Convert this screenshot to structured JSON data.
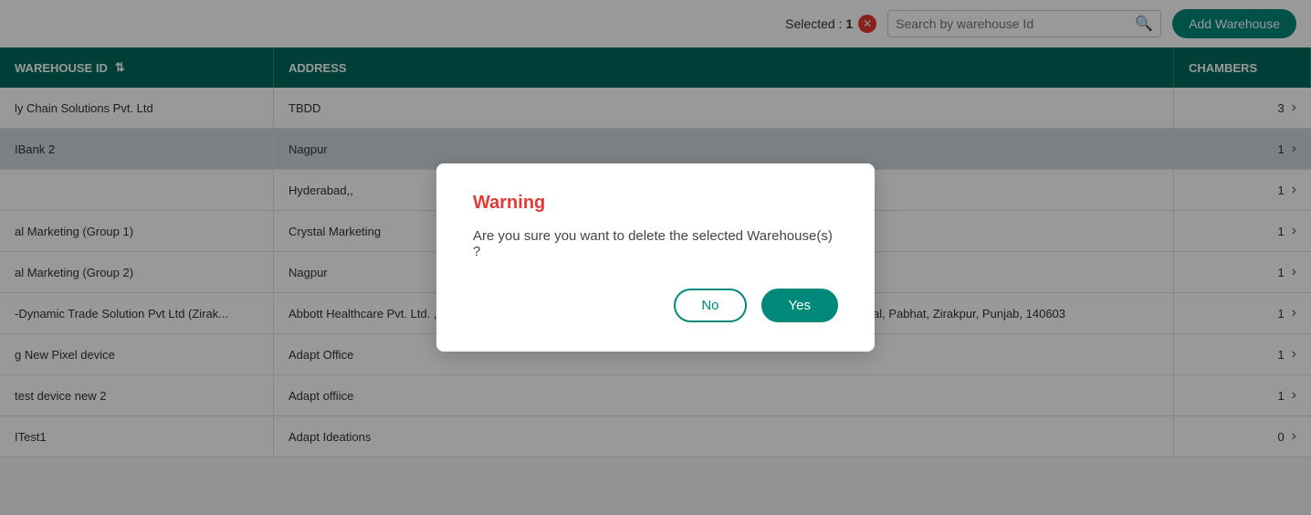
{
  "header": {
    "add_warehouse_label": "Add Warehouse",
    "selected_label": "Selected :",
    "selected_count": "1",
    "search_placeholder": "Search by warehouse Id"
  },
  "table": {
    "columns": [
      {
        "id": "warehouse_id",
        "label": "WAREHOUSE ID"
      },
      {
        "id": "address",
        "label": "ADDRESS"
      },
      {
        "id": "chambers",
        "label": "CHAMBERS"
      }
    ],
    "rows": [
      {
        "warehouse_id": "ly Chain Solutions Pvt. Ltd",
        "address": "TBDD",
        "chambers": "3",
        "highlighted": false
      },
      {
        "warehouse_id": "IBank 2",
        "address": "Nagpur",
        "chambers": "1",
        "highlighted": true
      },
      {
        "warehouse_id": "",
        "address": "Hyderabad,,",
        "chambers": "1",
        "highlighted": false
      },
      {
        "warehouse_id": "al Marketing (Group 1)",
        "address": "Crystal Marketing",
        "chambers": "1",
        "highlighted": false
      },
      {
        "warehouse_id": "al Marketing (Group 2)",
        "address": "Nagpur",
        "chambers": "1",
        "highlighted": false
      },
      {
        "warehouse_id": "-Dynamic Trade Solution Pvt Ltd (Zirak...",
        "address": "Abbott Healthcare Pvt. Ltd. , C/o Dynamic Trade Solutions Pvt. Ltd., Godown Area - B14 - A1, Behind JP Hospital, Pabhat, Zirakpur, Punjab, 140603",
        "chambers": "1",
        "highlighted": false
      },
      {
        "warehouse_id": "g New Pixel device",
        "address": "Adapt Office",
        "chambers": "1",
        "highlighted": false
      },
      {
        "warehouse_id": "test device new 2",
        "address": "Adapt offiice",
        "chambers": "1",
        "highlighted": false
      },
      {
        "warehouse_id": "ITest1",
        "address": "Adapt Ideations",
        "chambers": "0",
        "highlighted": false
      }
    ]
  },
  "modal": {
    "title": "Warning",
    "message": "Are you sure you want to delete the selected Warehouse(s) ?",
    "no_label": "No",
    "yes_label": "Yes"
  }
}
